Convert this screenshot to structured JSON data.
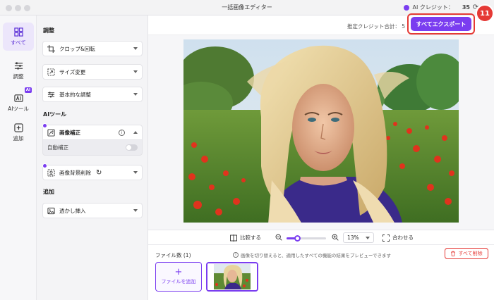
{
  "window": {
    "title": "一括画像エディター"
  },
  "credit": {
    "label": "AI クレジット：",
    "value": "35"
  },
  "rail": {
    "items": [
      {
        "label": "すべて",
        "active": true
      },
      {
        "label": "調整"
      },
      {
        "label": "AIツール",
        "badge": "AI"
      },
      {
        "label": "追加"
      }
    ]
  },
  "panel": {
    "section_adjust": "調整",
    "crop": "クロップ&回転",
    "resize": "サイズ変更",
    "basic": "基本的な調整",
    "section_ai": "AIツール",
    "enhance": "画像補正",
    "auto_enhance": "自動補正",
    "bg_remove": "画像背景削除",
    "section_add": "追加",
    "watermark": "透かし挿入"
  },
  "header": {
    "estimate": "推定クレジット合計： 5",
    "export_all": "すべてエクスポート",
    "step_badge": "11"
  },
  "controls": {
    "compare": "比較する",
    "zoom_value": "13%",
    "zoom_fraction": 0.27,
    "fit": "合わせる"
  },
  "files": {
    "count": "ファイル数 (1)",
    "hint": "画像を切り替えると、適用したすべての機能の結果をプレビューできます",
    "delete_all": "すべて削除",
    "add_file": "ファイルを追加"
  },
  "colors": {
    "accent": "#7a3df0",
    "danger": "#e53935"
  }
}
